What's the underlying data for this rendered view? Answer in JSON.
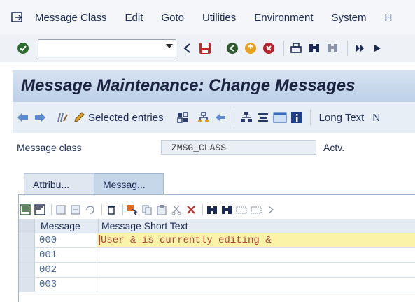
{
  "menubar": {
    "items": [
      "Message Class",
      "Edit",
      "Goto",
      "Utilities",
      "Environment",
      "System",
      "H"
    ]
  },
  "title": "Message Maintenance: Change Messages",
  "toolbar2": {
    "selected_entries": "Selected entries",
    "long_text": "Long Text",
    "more": "N"
  },
  "fields": {
    "message_class_label": "Message class",
    "message_class_value": "ZMSG_CLASS",
    "status": "Actv."
  },
  "tabs": [
    "Attribu...",
    "Messag..."
  ],
  "grid": {
    "headers": [
      "Message",
      "Message Short Text"
    ],
    "rows": [
      {
        "number": "000",
        "text": "User & is currently editing &"
      },
      {
        "number": "001",
        "text": ""
      },
      {
        "number": "002",
        "text": ""
      },
      {
        "number": "003",
        "text": ""
      }
    ]
  },
  "colors": {
    "title_bg": "#c8d8ec",
    "active_row": "#fbf3a8",
    "accent": "#d43a2a"
  }
}
